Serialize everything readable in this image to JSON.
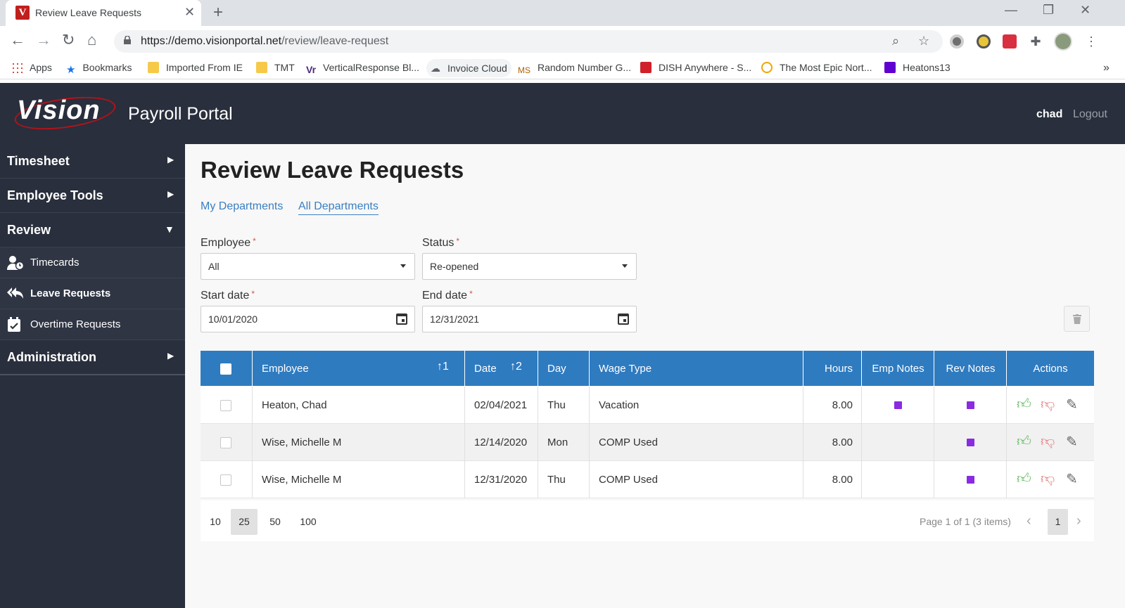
{
  "browser": {
    "tab_title": "Review Leave Requests",
    "url_host": "https://demo.visionportal.net",
    "url_path": "/review/leave-request",
    "bookmarks": [
      "Apps",
      "Bookmarks",
      "Imported From IE",
      "TMT",
      "VerticalResponse Bl...",
      "Invoice Cloud",
      "Random Number G...",
      "DISH Anywhere - S...",
      "The Most Epic Nort...",
      "Heatons13"
    ],
    "more": "»"
  },
  "header": {
    "logo": "Vision",
    "title": "Payroll Portal",
    "user": "chad",
    "logout": "Logout"
  },
  "sidebar": {
    "sections": [
      {
        "label": "Timesheet",
        "icon": "chevron-right-icon"
      },
      {
        "label": "Employee Tools",
        "icon": "chevron-right-icon"
      },
      {
        "label": "Review",
        "icon": "chevron-down-icon"
      },
      {
        "label": "Administration",
        "icon": "chevron-right-icon"
      }
    ],
    "review_items": [
      {
        "label": "Timecards",
        "icon": "user-clock-icon"
      },
      {
        "label": "Leave Requests",
        "icon": "reply-all-icon"
      },
      {
        "label": "Overtime Requests",
        "icon": "calendar-check-icon"
      }
    ]
  },
  "main": {
    "title": "Review Leave Requests",
    "tabs": [
      "My Departments",
      "All Departments"
    ],
    "active_tab": "All Departments",
    "filters": {
      "employee_label": "Employee",
      "employee_value": "All",
      "status_label": "Status",
      "status_value": "Re-opened",
      "start_label": "Start date",
      "start_value": "10/01/2020",
      "end_label": "End date",
      "end_value": "12/31/2021",
      "required_mark": "*"
    },
    "grid": {
      "columns": [
        "Employee",
        "Date",
        "Day",
        "Wage Type",
        "Hours",
        "Emp Notes",
        "Rev Notes",
        "Actions"
      ],
      "sort_employee": "↑1",
      "sort_date": "↑2",
      "rows": [
        {
          "employee": "Heaton, Chad",
          "date": "02/04/2021",
          "day": "Thu",
          "wage_type": "Vacation",
          "hours": "8.00",
          "emp_note": true,
          "rev_note": true
        },
        {
          "employee": "Wise, Michelle M",
          "date": "12/14/2020",
          "day": "Mon",
          "wage_type": "COMP Used",
          "hours": "8.00",
          "emp_note": false,
          "rev_note": true
        },
        {
          "employee": "Wise, Michelle M",
          "date": "12/31/2020",
          "day": "Thu",
          "wage_type": "COMP Used",
          "hours": "8.00",
          "emp_note": false,
          "rev_note": true
        }
      ]
    },
    "pager": {
      "sizes": [
        "10",
        "25",
        "50",
        "100"
      ],
      "active_size": "25",
      "info": "Page 1 of 1 (3 items)",
      "current_page": "1"
    }
  },
  "colors": {
    "header_bg": "#292f3c",
    "grid_header": "#2f7bc0",
    "link": "#3a7fc1",
    "approve": "#5cb85c",
    "reject": "#e47c7c",
    "note": "#8a2be2"
  }
}
